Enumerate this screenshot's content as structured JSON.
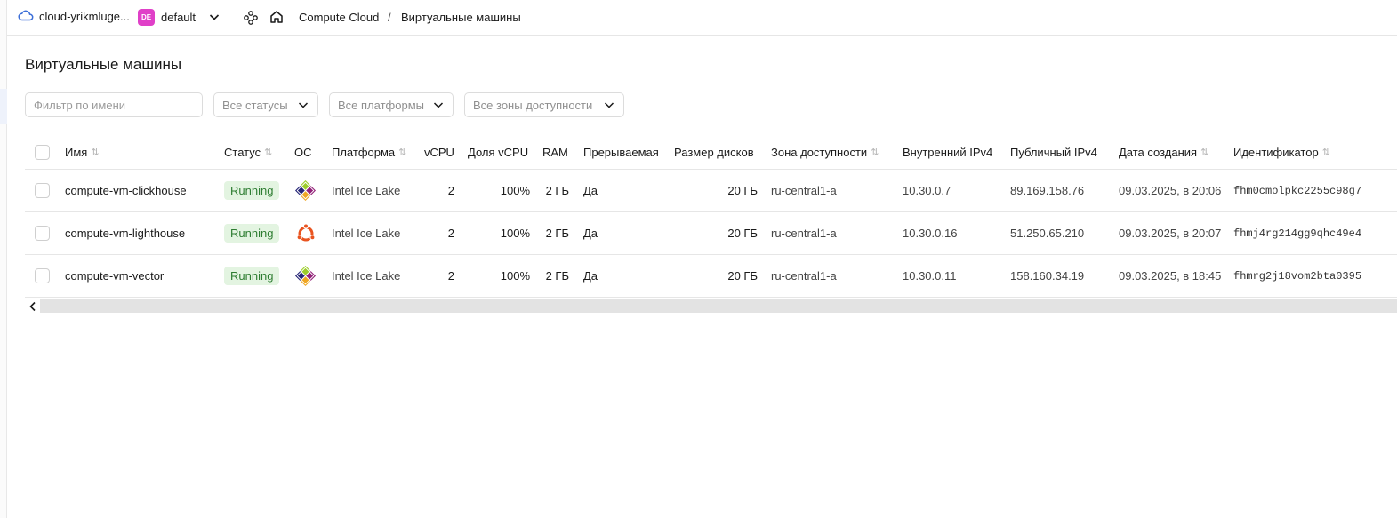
{
  "header": {
    "cloud_name": "cloud-yrikmluge...",
    "folder_badge": "DE",
    "folder_name": "default",
    "breadcrumb_service": "Compute Cloud",
    "breadcrumb_separator": "/",
    "breadcrumb_page": "Виртуальные машины"
  },
  "page": {
    "title": "Виртуальные машины"
  },
  "filters": {
    "name_placeholder": "Фильтр по имени",
    "status": "Все статусы",
    "platform": "Все платформы",
    "zone": "Все зоны доступности"
  },
  "table": {
    "columns": {
      "name": "Имя",
      "status": "Статус",
      "os": "ОС",
      "platform": "Платформа",
      "vcpu": "vCPU",
      "vcpu_share": "Доля vCPU",
      "ram": "RAM",
      "preemptible": "Прерываемая",
      "disk_size": "Размер дисков",
      "zone": "Зона доступности",
      "internal_ip": "Внутренний IPv4",
      "public_ip": "Публичный IPv4",
      "created": "Дата создания",
      "id": "Идентификатор"
    },
    "rows": [
      {
        "name": "compute-vm-clickhouse",
        "status": "Running",
        "os_icon": "centos-icon",
        "platform": "Intel Ice Lake",
        "vcpu": "2",
        "vcpu_share": "100%",
        "ram": "2 ГБ",
        "preemptible": "Да",
        "disk_size": "20 ГБ",
        "zone": "ru-central1-a",
        "internal_ip": "10.30.0.7",
        "public_ip": "89.169.158.76",
        "created": "09.03.2025, в 20:06",
        "id": "fhm0cmolpkc2255c98g7"
      },
      {
        "name": "compute-vm-lighthouse",
        "status": "Running",
        "os_icon": "ubuntu-icon",
        "platform": "Intel Ice Lake",
        "vcpu": "2",
        "vcpu_share": "100%",
        "ram": "2 ГБ",
        "preemptible": "Да",
        "disk_size": "20 ГБ",
        "zone": "ru-central1-a",
        "internal_ip": "10.30.0.16",
        "public_ip": "51.250.65.210",
        "created": "09.03.2025, в 20:07",
        "id": "fhmj4rg214gg9qhc49e4"
      },
      {
        "name": "compute-vm-vector",
        "status": "Running",
        "os_icon": "centos-icon",
        "platform": "Intel Ice Lake",
        "vcpu": "2",
        "vcpu_share": "100%",
        "ram": "2 ГБ",
        "preemptible": "Да",
        "disk_size": "20 ГБ",
        "zone": "ru-central1-a",
        "internal_ip": "10.30.0.11",
        "public_ip": "158.160.34.19",
        "created": "09.03.2025, в 18:45",
        "id": "fhmrg2j18vom2bta0395"
      }
    ]
  },
  "colors": {
    "accent": "#3d6fd8",
    "folder_badge": "#e040c8",
    "status_running_bg": "#e3f4e1",
    "status_running_text": "#2e7d32",
    "ubuntu": "#e95420"
  }
}
